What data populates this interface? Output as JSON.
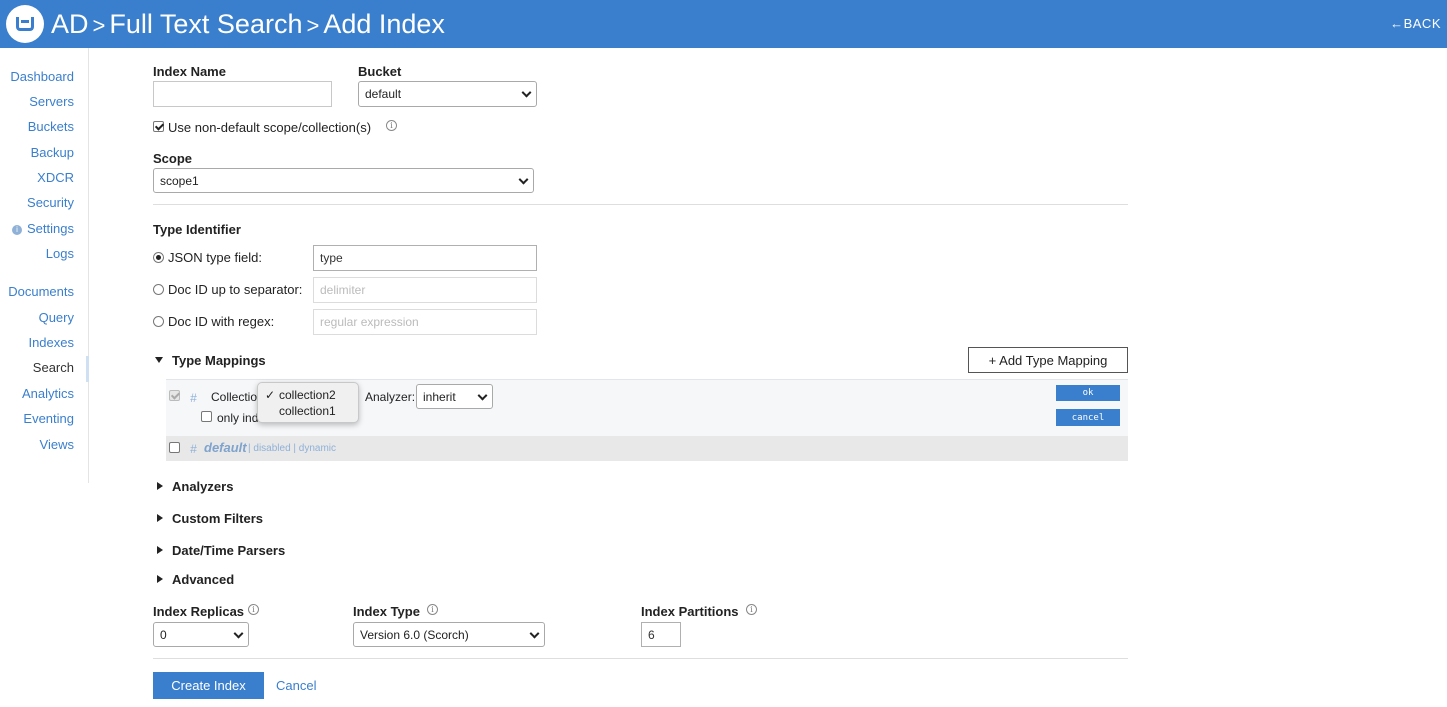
{
  "header": {
    "crumbs": [
      "AD",
      "Full Text Search",
      "Add Index"
    ],
    "back_label": "BACK",
    "color": "#3a7fcd"
  },
  "nav": {
    "group1": [
      "Dashboard",
      "Servers",
      "Buckets",
      "Backup",
      "XDCR",
      "Security",
      "Settings",
      "Logs"
    ],
    "group2": [
      "Documents",
      "Query",
      "Indexes",
      "Search",
      "Analytics",
      "Eventing",
      "Views"
    ],
    "active": "Search"
  },
  "form": {
    "index_name": {
      "label": "Index Name",
      "value": ""
    },
    "bucket": {
      "label": "Bucket",
      "value": "default"
    },
    "non_default_scope": {
      "label": "Use non-default scope/collection(s)",
      "checked": true
    },
    "scope": {
      "label": "Scope",
      "value": "scope1"
    },
    "type_identifier": {
      "label": "Type Identifier",
      "options": [
        {
          "label": "JSON type field:",
          "value": "type",
          "placeholder": "",
          "selected": true
        },
        {
          "label": "Doc ID up to separator:",
          "value": "",
          "placeholder": "delimiter",
          "selected": false
        },
        {
          "label": "Doc ID with regex:",
          "value": "",
          "placeholder": "regular expression",
          "selected": false
        }
      ]
    },
    "type_mappings": {
      "label": "Type Mappings",
      "add_label": "+ Add Type Mapping",
      "editor": {
        "collection_label": "Collection",
        "only_index_label": "only index",
        "analyzer_label": "Analyzer:",
        "analyzer_value": "inherit",
        "ok_label": "ok",
        "cancel_label": "cancel",
        "dropdown_options": [
          "collection2",
          "collection1"
        ],
        "dropdown_selected": "collection2"
      },
      "default_row": {
        "name": "default",
        "meta": "| disabled | dynamic"
      }
    },
    "sections": [
      "Analyzers",
      "Custom Filters",
      "Date/Time Parsers",
      "Advanced"
    ],
    "index_replicas": {
      "label": "Index Replicas",
      "value": "0"
    },
    "index_type": {
      "label": "Index Type",
      "value": "Version 6.0 (Scorch)"
    },
    "index_partitions": {
      "label": "Index Partitions",
      "value": "6"
    }
  },
  "actions": {
    "create": "Create Index",
    "cancel": "Cancel"
  }
}
